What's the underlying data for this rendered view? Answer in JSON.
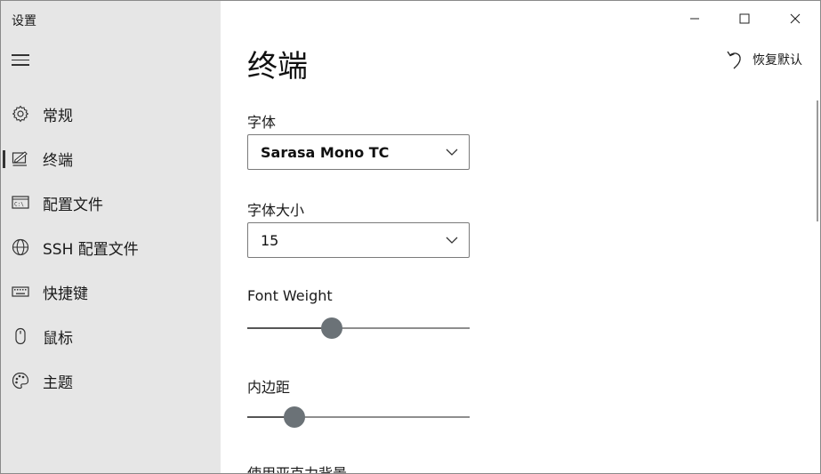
{
  "window": {
    "title": "设置",
    "controls": {
      "minimize": "minimize-icon",
      "maximize": "maximize-icon",
      "close": "close-icon"
    }
  },
  "sidebar": {
    "menu_icon": "hamburger-icon",
    "items": [
      {
        "label": "常规",
        "icon": "gear-icon",
        "selected": false
      },
      {
        "label": "终端",
        "icon": "terminal-edit-icon",
        "selected": true
      },
      {
        "label": "配置文件",
        "icon": "profile-icon",
        "selected": false
      },
      {
        "label": "SSH 配置文件",
        "icon": "globe-icon",
        "selected": false
      },
      {
        "label": "快捷键",
        "icon": "keyboard-icon",
        "selected": false
      },
      {
        "label": "鼠标",
        "icon": "mouse-icon",
        "selected": false
      },
      {
        "label": "主题",
        "icon": "palette-icon",
        "selected": false
      }
    ]
  },
  "main": {
    "title": "终端",
    "reset_label": "恢复默认",
    "font": {
      "label": "字体",
      "value": "Sarasa Mono TC"
    },
    "font_size": {
      "label": "字体大小",
      "value": "15"
    },
    "font_weight": {
      "label": "Font Weight",
      "fraction": 0.38
    },
    "padding": {
      "label": "内边距",
      "fraction": 0.21
    },
    "next_section_label": "使用亚克力背景"
  },
  "colors": {
    "sidebar_bg": "#e6e6e6",
    "main_bg": "#ffffff",
    "slider_thumb": "#6b7277",
    "slider_track": "#8e8e8e"
  }
}
